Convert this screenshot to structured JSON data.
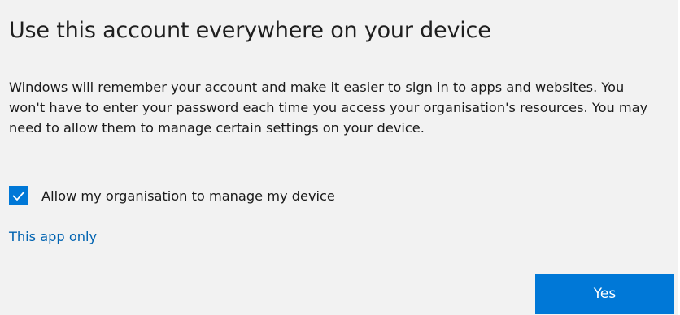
{
  "dialog": {
    "title": "Use this account everywhere on your device",
    "body": "Windows will remember your account and make it easier to sign in to apps and websites. You won't have to enter your password each time you access your organisation's resources. You may need to allow them to manage certain settings on your device.",
    "checkbox": {
      "label": "Allow my organisation to manage my device",
      "checked": true
    },
    "link_label": "This app only",
    "primary_button_label": "Yes"
  },
  "colors": {
    "accent": "#0078d7",
    "link": "#0063b1",
    "background": "#f2f2f2"
  },
  "icons": {
    "checkbox": "checkmark-icon"
  }
}
